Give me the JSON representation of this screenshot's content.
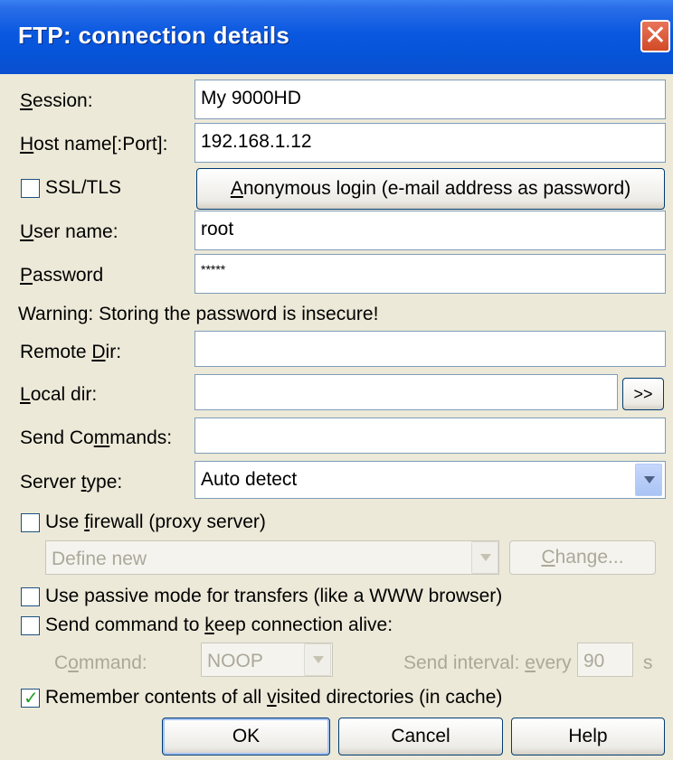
{
  "window": {
    "title": "FTP: connection details",
    "close_glyph": "✕"
  },
  "fields": {
    "session": {
      "label_key": "S",
      "label_rest": "ession:",
      "value": "My 9000HD"
    },
    "host": {
      "label_key": "H",
      "label_rest": "ost name[:Port]:",
      "value": "192.168.1.12"
    },
    "ssl": {
      "label": "SSL/TLS",
      "checked": false
    },
    "anonymous_button": {
      "key": "A",
      "rest": "nonymous login (e-mail address as password)"
    },
    "user": {
      "label_key": "U",
      "label_rest": "ser name:",
      "value": "root"
    },
    "password": {
      "label_key": "P",
      "label_rest": "assword",
      "value": "*****"
    },
    "warning": "Warning: Storing the password is insecure!",
    "remote_dir": {
      "label_pre": "Remote ",
      "label_key": "D",
      "label_rest": "ir:",
      "value": ""
    },
    "local_dir": {
      "label_key": "L",
      "label_rest": "ocal dir:",
      "value": "",
      "browse": ">>"
    },
    "send_commands": {
      "label_pre": "Send Co",
      "label_key": "m",
      "label_rest": "mands:",
      "value": ""
    },
    "server_type": {
      "label_pre": "Server ",
      "label_key": "t",
      "label_rest": "ype:",
      "value": "Auto detect"
    }
  },
  "firewall": {
    "checkbox_pre": "Use ",
    "checkbox_key": "f",
    "checkbox_rest": "irewall (proxy server)",
    "checked": false,
    "proxy_value": "Define new",
    "change_key": "C",
    "change_rest": "hange..."
  },
  "passive": {
    "label": "Use passive mode for transfers (like a WWW browser)",
    "checked": false
  },
  "keepalive": {
    "pre": "Send command to ",
    "key": "k",
    "rest": "eep connection alive:",
    "checked": false,
    "command_label_pre": "C",
    "command_label_key": "o",
    "command_label_rest": "mmand:",
    "command_value": "NOOP",
    "interval_label_pre": "Send interval: ",
    "interval_label_key": "e",
    "interval_label_rest": "very",
    "interval_value": "90",
    "interval_unit": "s"
  },
  "cache": {
    "pre": "Remember contents of all ",
    "key": "v",
    "rest": "isited directories (in cache)",
    "checked": true,
    "check_glyph": "✓"
  },
  "buttons": {
    "ok": "OK",
    "cancel": "Cancel",
    "help": "Help"
  }
}
